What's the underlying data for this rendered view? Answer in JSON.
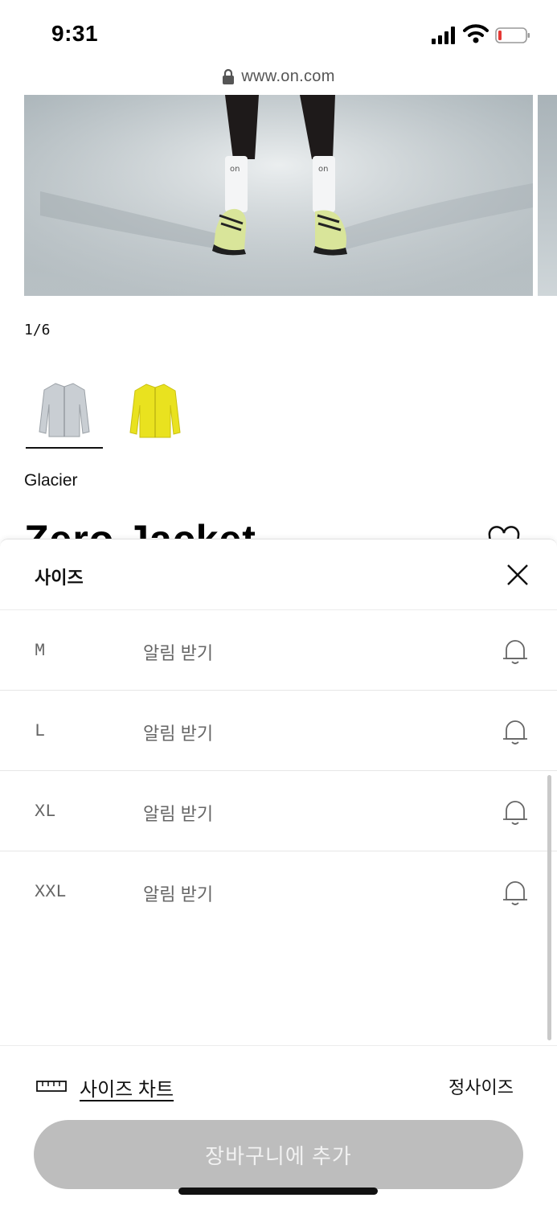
{
  "status_bar": {
    "time": "9:31"
  },
  "browser": {
    "url": "www.on.com"
  },
  "gallery": {
    "counter": "1/6"
  },
  "colors": {
    "selected_name": "Glacier",
    "swatches": [
      {
        "name": "Glacier",
        "hex": "#c9ced3"
      },
      {
        "name": "yellow",
        "hex": "#e9e21f"
      }
    ]
  },
  "product": {
    "title": "Zero Jacket"
  },
  "size_sheet": {
    "title": "사이즈",
    "rows": [
      {
        "size": "M",
        "action": "알림 받기"
      },
      {
        "size": "L",
        "action": "알림 받기"
      },
      {
        "size": "XL",
        "action": "알림 받기"
      },
      {
        "size": "XXL",
        "action": "알림 받기"
      }
    ],
    "size_chart_label": "사이즈 차트",
    "fit_label": "정사이즈",
    "add_to_cart_label": "장바구니에 추가"
  },
  "theme": {
    "disabled_button": "#bdbdbd",
    "muted_text": "#666666"
  }
}
